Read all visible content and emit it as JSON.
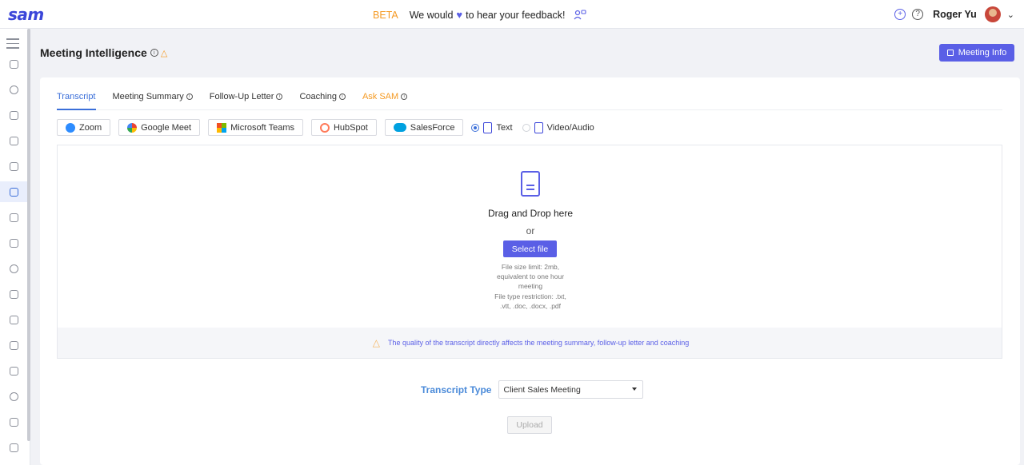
{
  "app": {
    "logo": "sam"
  },
  "banner": {
    "beta": "BETA",
    "text_before": "We would",
    "text_after": "to hear your feedback!"
  },
  "user": {
    "name": "Roger Yu"
  },
  "page": {
    "title": "Meeting Intelligence",
    "meeting_info_label": "Meeting Info"
  },
  "tabs": [
    {
      "label": "Transcript"
    },
    {
      "label": "Meeting Summary"
    },
    {
      "label": "Follow-Up Letter"
    },
    {
      "label": "Coaching"
    },
    {
      "label": "Ask SAM"
    }
  ],
  "sources": [
    {
      "label": "Zoom",
      "color": "#2d8cff"
    },
    {
      "label": "Google Meet",
      "color": "#ea4335"
    },
    {
      "label": "Microsoft Teams",
      "color": "#7fba00"
    },
    {
      "label": "HubSpot",
      "color": "#ff7a59"
    },
    {
      "label": "SalesForce",
      "color": "#00a1e0"
    }
  ],
  "input_mode": {
    "text_label": "Text",
    "video_label": "Video/Audio",
    "selected": "Text"
  },
  "dropzone": {
    "title": "Drag and Drop here",
    "or": "or",
    "button": "Select file",
    "limit_1": "File size limit: 2mb,",
    "limit_2": "equivalent to one hour",
    "limit_3": "meeting",
    "restriction_1": "File type restriction: .txt,",
    "restriction_2": ".vtt, .doc, .docx, .pdf",
    "quality_note": "The quality of the transcript directly affects the meeting summary, follow-up letter and coaching"
  },
  "transcript_type": {
    "label": "Transcript Type",
    "value": "Client Sales Meeting"
  },
  "upload_label": "Upload",
  "colors": {
    "accent": "#5a5fe6",
    "beta": "#f59a23",
    "active_tab": "#3b6fd9"
  }
}
